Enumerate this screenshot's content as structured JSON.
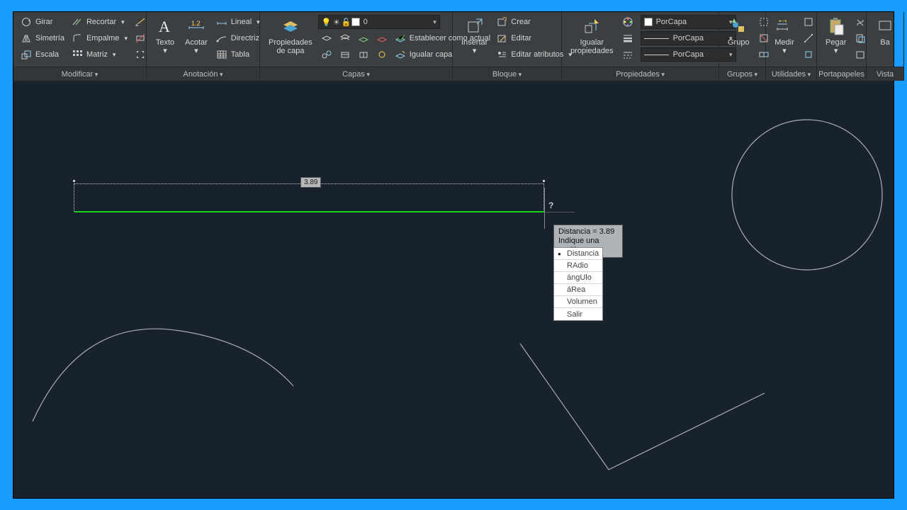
{
  "ribbon": {
    "modify": {
      "title": "Modificar",
      "girar": "Girar",
      "recortar": "Recortar",
      "simetria": "Simetría",
      "empalme": "Empalme",
      "escala": "Escala",
      "matriz": "Matriz"
    },
    "annotation": {
      "title": "Anotación",
      "texto": "Texto",
      "acotar": "Acotar",
      "lineal": "Lineal",
      "directriz": "Directriz",
      "tabla": "Tabla"
    },
    "layers": {
      "title": "Capas",
      "propiedades": "Propiedades\nde capa",
      "current_layer": "0",
      "establecer": "Establecer como actual",
      "igualar": "Igualar capa"
    },
    "block": {
      "title": "Bloque",
      "insertar": "Insertar",
      "crear": "Crear",
      "editar": "Editar",
      "atributos": "Editar atributos"
    },
    "properties": {
      "title": "Propiedades",
      "igualar": "Igualar\npropiedades",
      "porcapa1": "PorCapa",
      "porcapa2": "PorCapa",
      "porcapa3": "PorCapa"
    },
    "groups": {
      "title": "Grupos",
      "grupo": "Grupo"
    },
    "utilities": {
      "title": "Utilidades",
      "medir": "Medir"
    },
    "clipboard": {
      "title": "Portapapeles",
      "pegar": "Pegar"
    },
    "view": {
      "title": "Vista",
      "base": "Ba"
    }
  },
  "canvas": {
    "dim_value": "3.89",
    "q": "?",
    "tooltip_line1": "Distancia = 3.89",
    "tooltip_line2": "Indique una opción",
    "options": [
      "Distancia",
      "RAdio",
      "ángUlo",
      "áRea",
      "Volumen",
      "Salir"
    ],
    "selected_index": 0
  }
}
